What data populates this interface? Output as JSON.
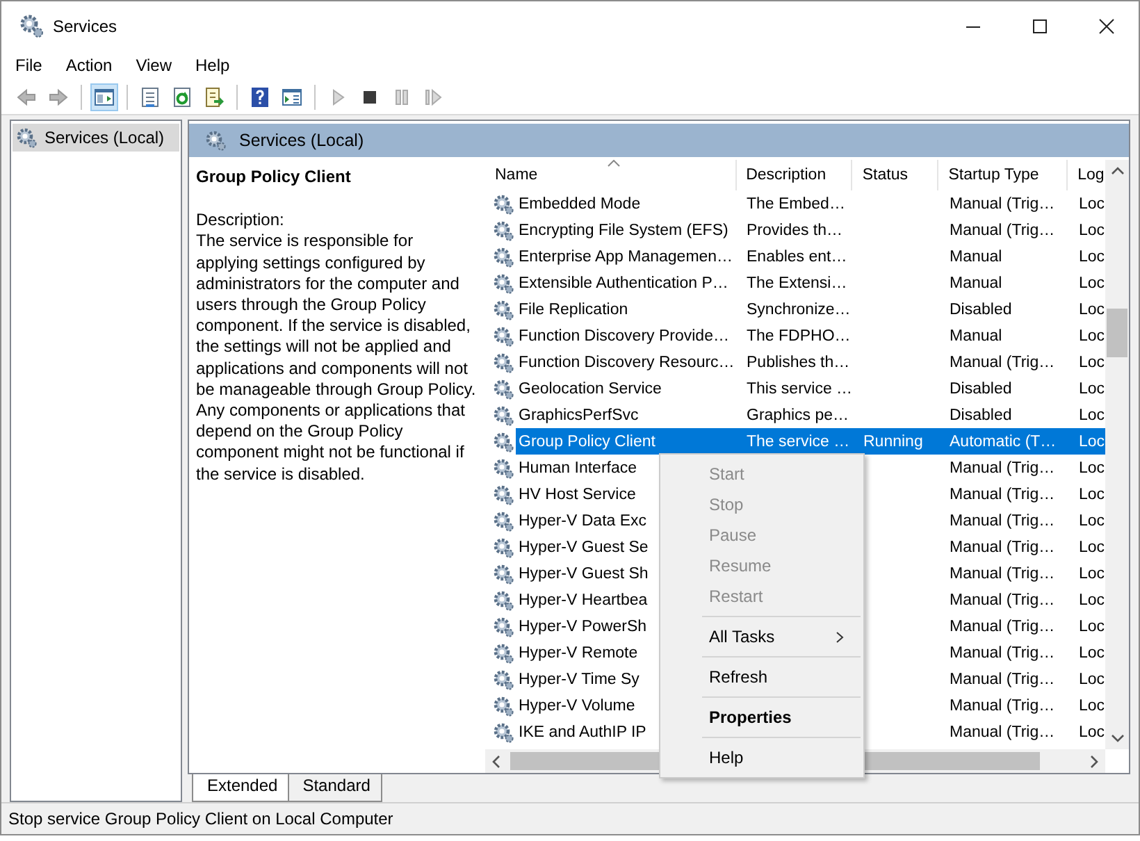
{
  "window": {
    "title": "Services"
  },
  "menu": [
    "File",
    "Action",
    "View",
    "Help"
  ],
  "toolbar": [
    [
      {
        "kind": "back",
        "pressed": false,
        "disabled": true
      },
      {
        "kind": "forward",
        "pressed": false,
        "disabled": true
      }
    ],
    [
      {
        "kind": "tree",
        "pressed": true,
        "disabled": false
      }
    ],
    [
      {
        "kind": "properties",
        "pressed": false,
        "disabled": false
      },
      {
        "kind": "refresh",
        "pressed": false,
        "disabled": false
      },
      {
        "kind": "export",
        "pressed": false,
        "disabled": false
      }
    ],
    [
      {
        "kind": "help",
        "pressed": false,
        "disabled": false
      },
      {
        "kind": "view",
        "pressed": false,
        "disabled": false
      }
    ],
    [
      {
        "kind": "start",
        "pressed": false,
        "disabled": true
      },
      {
        "kind": "stop",
        "pressed": false,
        "disabled": false
      },
      {
        "kind": "pause",
        "pressed": false,
        "disabled": true
      },
      {
        "kind": "resume",
        "pressed": false,
        "disabled": true
      }
    ]
  ],
  "tree": {
    "items": [
      {
        "label": "Services (Local)",
        "selected": true
      }
    ]
  },
  "pane": {
    "title": "Services (Local)"
  },
  "detail": {
    "title": "Group Policy Client",
    "label": "Description:",
    "text": "The service is responsible for applying settings configured by administrators for the computer and users through the Group Policy component. If the service is disabled, the settings will not be applied and applications and components will not be manageable through Group Policy. Any components or applications that depend on the Group Policy component might not be functional if the service is disabled."
  },
  "table": {
    "columns": [
      "Name",
      "Description",
      "Status",
      "Startup Type",
      "Log"
    ],
    "rows": [
      {
        "name": "Embedded Mode",
        "description": "The Embed…",
        "startup": "Manual (Trig…",
        "log": "Loc",
        "selected": false
      },
      {
        "name": "Encrypting File System (EFS)",
        "description": "Provides th…",
        "startup": "Manual (Trig…",
        "log": "Loc",
        "selected": false
      },
      {
        "name": "Enterprise App Managemen…",
        "description": "Enables ent…",
        "startup": "Manual",
        "log": "Loc",
        "selected": false
      },
      {
        "name": "Extensible Authentication P…",
        "description": "The Extensi…",
        "startup": "Manual",
        "log": "Loc",
        "selected": false
      },
      {
        "name": "File Replication",
        "description": "Synchronize…",
        "startup": "Disabled",
        "log": "Loc",
        "selected": false
      },
      {
        "name": "Function Discovery Provide…",
        "description": "The FDPHO…",
        "startup": "Manual",
        "log": "Loc",
        "selected": false
      },
      {
        "name": "Function Discovery Resourc…",
        "description": "Publishes th…",
        "startup": "Manual (Trig…",
        "log": "Loc",
        "selected": false
      },
      {
        "name": "Geolocation Service",
        "description": "This service …",
        "startup": "Disabled",
        "log": "Loc",
        "selected": false
      },
      {
        "name": "GraphicsPerfSvc",
        "description": "Graphics pe…",
        "startup": "Disabled",
        "log": "Loc",
        "selected": false
      },
      {
        "name": "Group Policy Client",
        "description": "The service …",
        "status": "Running",
        "startup": "Automatic (T…",
        "log": "Loc",
        "selected": true
      },
      {
        "name": "Human Interface",
        "startup": "Manual (Trig…",
        "log": "Loc",
        "selected": false
      },
      {
        "name": "HV Host Service",
        "startup": "Manual (Trig…",
        "log": "Loc",
        "selected": false
      },
      {
        "name": "Hyper-V Data Exc",
        "startup": "Manual (Trig…",
        "log": "Loc",
        "selected": false
      },
      {
        "name": "Hyper-V Guest Se",
        "startup": "Manual (Trig…",
        "log": "Loc",
        "selected": false
      },
      {
        "name": "Hyper-V Guest Sh",
        "startup": "Manual (Trig…",
        "log": "Loc",
        "selected": false
      },
      {
        "name": "Hyper-V Heartbea",
        "startup": "Manual (Trig…",
        "log": "Loc",
        "selected": false
      },
      {
        "name": "Hyper-V PowerSh",
        "startup": "Manual (Trig…",
        "log": "Loc",
        "selected": false
      },
      {
        "name": "Hyper-V Remote",
        "startup": "Manual (Trig…",
        "log": "Loc",
        "selected": false
      },
      {
        "name": "Hyper-V Time Sy",
        "startup": "Manual (Trig…",
        "log": "Loc",
        "selected": false
      },
      {
        "name": "Hyper-V Volume",
        "startup": "Manual (Trig…",
        "log": "Loc",
        "selected": false
      },
      {
        "name": "IKE and AuthIP IP",
        "startup": "Manual (Trig…",
        "log": "Loc",
        "selected": false
      }
    ]
  },
  "context_menu": {
    "groups": [
      [
        {
          "label": "Start",
          "disabled": true,
          "submenu": false,
          "default": false
        },
        {
          "label": "Stop",
          "disabled": true,
          "submenu": false,
          "default": false
        },
        {
          "label": "Pause",
          "disabled": true,
          "submenu": false,
          "default": false
        },
        {
          "label": "Resume",
          "disabled": true,
          "submenu": false,
          "default": false
        },
        {
          "label": "Restart",
          "disabled": true,
          "submenu": false,
          "default": false
        }
      ],
      [
        {
          "label": "All Tasks",
          "disabled": false,
          "submenu": true,
          "default": false
        }
      ],
      [
        {
          "label": "Refresh",
          "disabled": false,
          "submenu": false,
          "default": false
        }
      ],
      [
        {
          "label": "Properties",
          "disabled": false,
          "submenu": false,
          "default": true
        }
      ],
      [
        {
          "label": "Help",
          "disabled": false,
          "submenu": false,
          "default": false
        }
      ]
    ]
  },
  "tabs": [
    {
      "label": "Extended",
      "selected": true
    },
    {
      "label": "Standard",
      "selected": false
    }
  ],
  "status_bar": "Stop service Group Policy Client on Local Computer"
}
